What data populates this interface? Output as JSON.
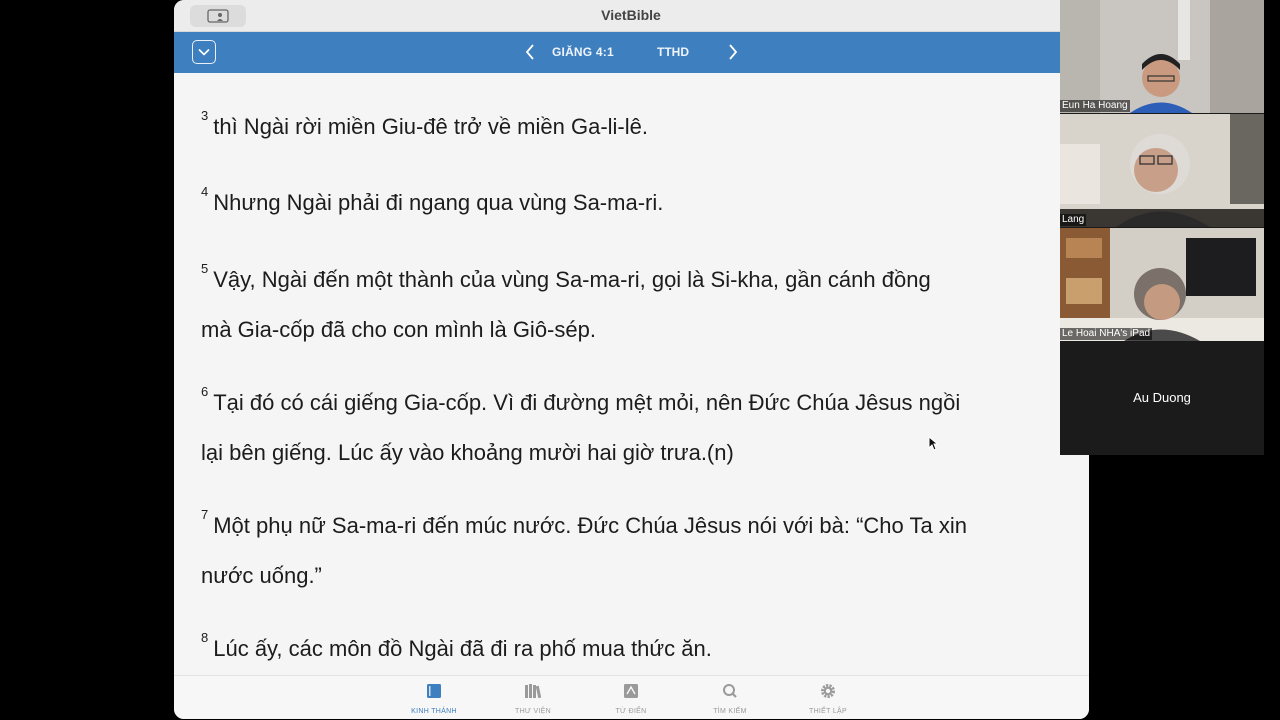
{
  "window": {
    "title": "VietBible"
  },
  "nav": {
    "reference": "GIĂNG 4:1",
    "version": "TTHD"
  },
  "verses": [
    {
      "num": "3",
      "line1": "thì Ngài rời miền Giu-đê trở về miền Ga-li-lê.",
      "line2": ""
    },
    {
      "num": "4",
      "line1": "Nhưng Ngài phải đi ngang qua vùng Sa-ma-ri.",
      "line2": ""
    },
    {
      "num": "5",
      "line1": "Vậy, Ngài đến một thành của vùng Sa-ma-ri, gọi là Si-kha, gần cánh đồng",
      "line2": "mà Gia-cốp đã cho con mình là Giô-sép."
    },
    {
      "num": "6",
      "line1": "Tại đó có cái giếng Gia-cốp. Vì đi đường mệt mỏi, nên Đức Chúa Jêsus ngồi",
      "line2": "lại bên giếng. Lúc ấy vào khoảng mười hai giờ trưa.(n)"
    },
    {
      "num": "7",
      "line1": "Một phụ nữ Sa-ma-ri đến múc nước. Đức Chúa Jêsus nói với bà: “Cho Ta xin",
      "line2": "nước uống.”"
    },
    {
      "num": "8",
      "line1": "Lúc ấy, các môn đồ Ngài đã đi ra phố mua thức ăn.",
      "line2": ""
    }
  ],
  "tabs": [
    {
      "label": "KINH THÁNH",
      "icon": "book-icon",
      "active": true
    },
    {
      "label": "THƯ VIỆN",
      "icon": "library-icon",
      "active": false
    },
    {
      "label": "TỪ ĐIỂN",
      "icon": "dictionary-icon",
      "active": false
    },
    {
      "label": "TÌM KIẾM",
      "icon": "search-icon",
      "active": false
    },
    {
      "label": "THIẾT LẬP",
      "icon": "gear-icon",
      "active": false
    }
  ],
  "participants": [
    {
      "name": "Eun Ha Hoang"
    },
    {
      "name": "Lang"
    },
    {
      "name": "Le Hoai NHA's iPad"
    },
    {
      "name": "Au Duong"
    }
  ],
  "colors": {
    "accent": "#3e7fbf",
    "text": "#1c1c1c",
    "tab_inactive": "#9a9a9a"
  }
}
